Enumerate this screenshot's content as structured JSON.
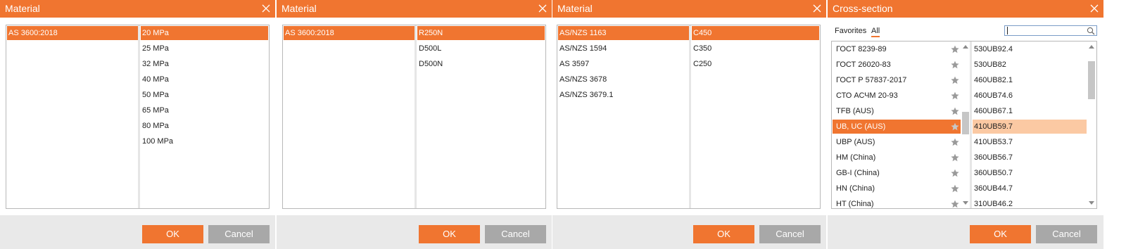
{
  "colors": {
    "accent": "#f07530",
    "accent_soft": "#fbc9a3",
    "footer": "#e9e9e9",
    "cancel": "#a8a8a8"
  },
  "dialogs": [
    {
      "title": "Material",
      "left_list": [
        "AS 3600:2018"
      ],
      "left_selected": 0,
      "right_list": [
        "20 MPa",
        "25 MPa",
        "32 MPa",
        "40 MPa",
        "50 MPa",
        "65 MPa",
        "80 MPa",
        "100 MPa"
      ],
      "right_selected": 0,
      "ok_label": "OK",
      "cancel_label": "Cancel"
    },
    {
      "title": "Material",
      "left_list": [
        "AS 3600:2018"
      ],
      "left_selected": 0,
      "right_list": [
        "R250N",
        "D500L",
        "D500N"
      ],
      "right_selected": 0,
      "ok_label": "OK",
      "cancel_label": "Cancel"
    },
    {
      "title": "Material",
      "left_list": [
        "AS/NZS 1163",
        "AS/NZS 1594",
        "AS 3597",
        "AS/NZS 3678",
        "AS/NZS 3679.1"
      ],
      "left_selected": 0,
      "right_list": [
        "C450",
        "C350",
        "C250"
      ],
      "right_selected": 0,
      "ok_label": "OK",
      "cancel_label": "Cancel"
    }
  ],
  "cross_section": {
    "title": "Cross-section",
    "tabs": {
      "favorites": "Favorites",
      "all": "All"
    },
    "active_tab": "all",
    "search": {
      "value": "",
      "icon": "search-icon"
    },
    "standards": [
      "ГОСТ 8239-89",
      "ГОСТ 26020-83",
      "ГОСТ Р 57837-2017",
      "СТО АСЧМ 20-93",
      "TFB (AUS)",
      "UB, UC (AUS)",
      "UBP (AUS)",
      "HM (China)",
      "GB-I (China)",
      "HN (China)",
      "HT (China)"
    ],
    "standards_selected": 5,
    "star_icon": "star-icon",
    "sections": [
      "530UB92.4",
      "530UB82",
      "460UB82.1",
      "460UB74.6",
      "460UB67.1",
      "410UB59.7",
      "410UB53.7",
      "360UB56.7",
      "360UB50.7",
      "360UB44.7",
      "310UB46.2"
    ],
    "sections_selected": 5,
    "ok_label": "OK",
    "cancel_label": "Cancel"
  }
}
